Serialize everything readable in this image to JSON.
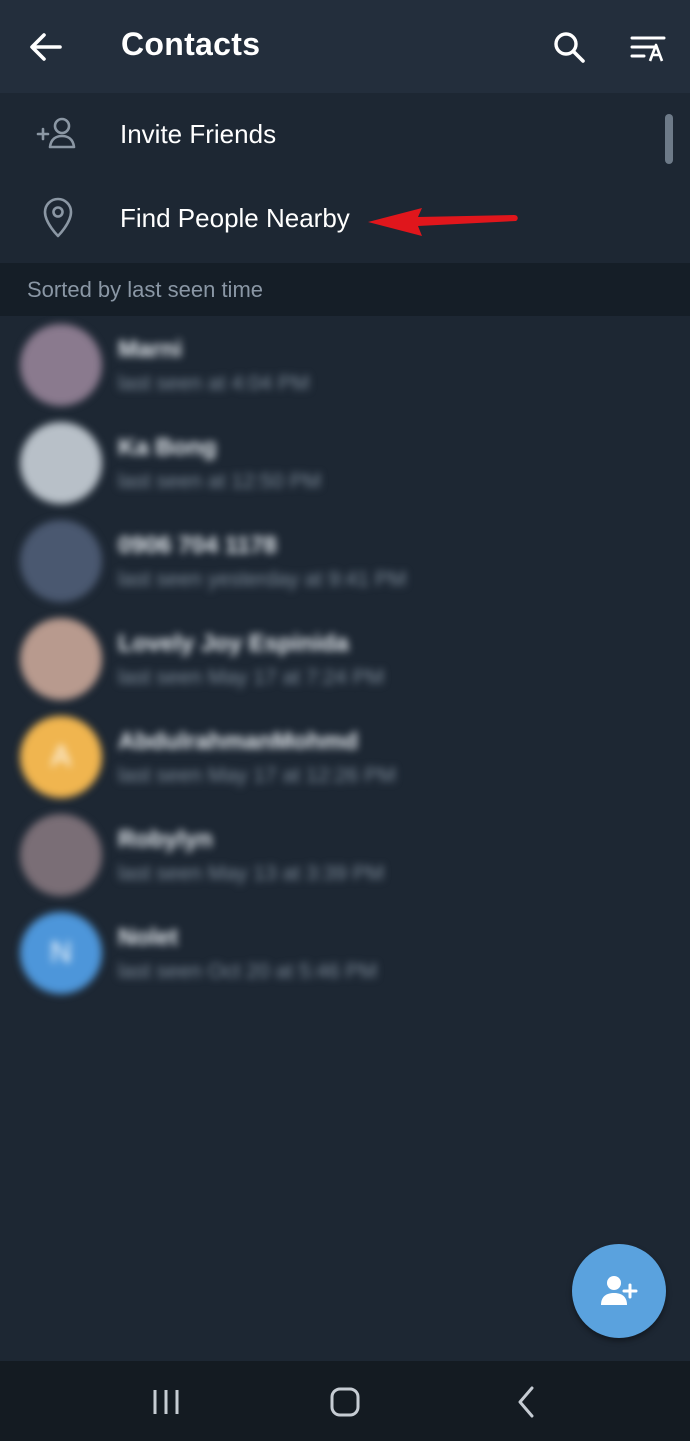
{
  "header": {
    "title": "Contacts"
  },
  "menu": [
    {
      "label": "Invite Friends",
      "icon": "add-person-icon"
    },
    {
      "label": "Find People Nearby",
      "icon": "location-pin-icon"
    }
  ],
  "section": {
    "label": "Sorted by last seen time"
  },
  "contacts": [
    {
      "name": "Marni",
      "status": "last seen at 4:04 PM",
      "avatar_color": "#8a7a8e",
      "initial": ""
    },
    {
      "name": "Ka Bong",
      "status": "last seen at 12:50 PM",
      "avatar_color": "#b8c0c8",
      "initial": ""
    },
    {
      "name": "0906 704 1178",
      "status": "last seen yesterday at 9:41 PM",
      "avatar_color": "#4a5870",
      "initial": ""
    },
    {
      "name": "Lovely Joy Espinida",
      "status": "last seen May 17 at 7:24 PM",
      "avatar_color": "#b89a8e",
      "initial": ""
    },
    {
      "name": "AbdulrahmanMohmd",
      "status": "last seen May 17 at 12:26 PM",
      "avatar_color": "#f0b54f",
      "initial": "A"
    },
    {
      "name": "Robylyn",
      "status": "last seen May 13 at 3:39 PM",
      "avatar_color": "#7a6e76",
      "initial": ""
    },
    {
      "name": "Nolet",
      "status": "last seen Oct 20 at 5:46 PM",
      "avatar_color": "#4d96da",
      "initial": "N"
    }
  ],
  "colors": {
    "background": "#1d2733",
    "header": "#232e3c",
    "accent": "#5aa2de",
    "annotation": "#e0161c"
  }
}
